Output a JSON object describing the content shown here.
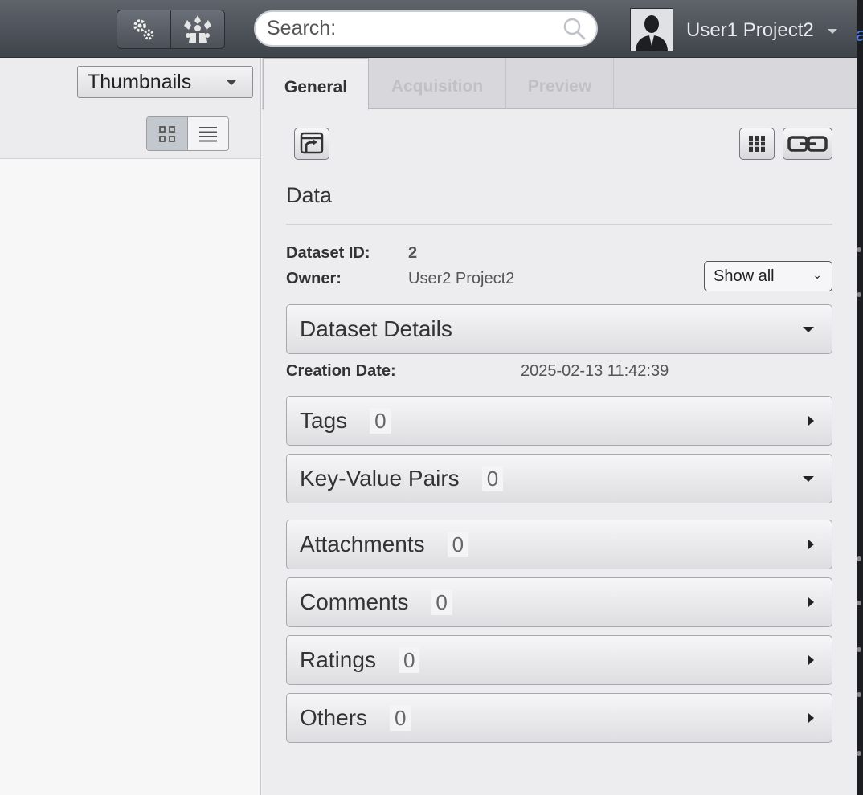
{
  "header": {
    "search_placeholder": "Search:",
    "user_name": "User1 Project2",
    "settings_icon": "gears-icon",
    "share_icon": "group-icon"
  },
  "left_panel": {
    "view_mode": "Thumbnails",
    "layout_options": [
      "grid-view-icon",
      "list-view-icon"
    ],
    "active_layout": "grid"
  },
  "right_panel": {
    "tabs": [
      {
        "label": "General",
        "active": true
      },
      {
        "label": "Acquisition",
        "active": false
      },
      {
        "label": "Preview",
        "active": false
      }
    ],
    "section_title": "Data",
    "dataset_id_label": "Dataset ID:",
    "dataset_id": "2",
    "owner_label": "Owner:",
    "owner": "User2 Project2",
    "show_all": "Show all",
    "details_title": "Dataset Details",
    "creation_date_label": "Creation Date:",
    "creation_date": "2025-02-13 11:42:39",
    "sections": [
      {
        "title": "Tags",
        "count": "0",
        "expanded": false
      },
      {
        "title": "Key-Value Pairs",
        "count": "0",
        "expanded": true
      },
      {
        "title": "Attachments",
        "count": "0",
        "expanded": false
      },
      {
        "title": "Comments",
        "count": "0",
        "expanded": false
      },
      {
        "title": "Ratings",
        "count": "0",
        "expanded": false
      },
      {
        "title": "Others",
        "count": "0",
        "expanded": false
      }
    ]
  },
  "colors": {
    "topbar": "#4f545b",
    "pane_bg": "#ededf0",
    "accent_edge": "#4a7ff0"
  }
}
